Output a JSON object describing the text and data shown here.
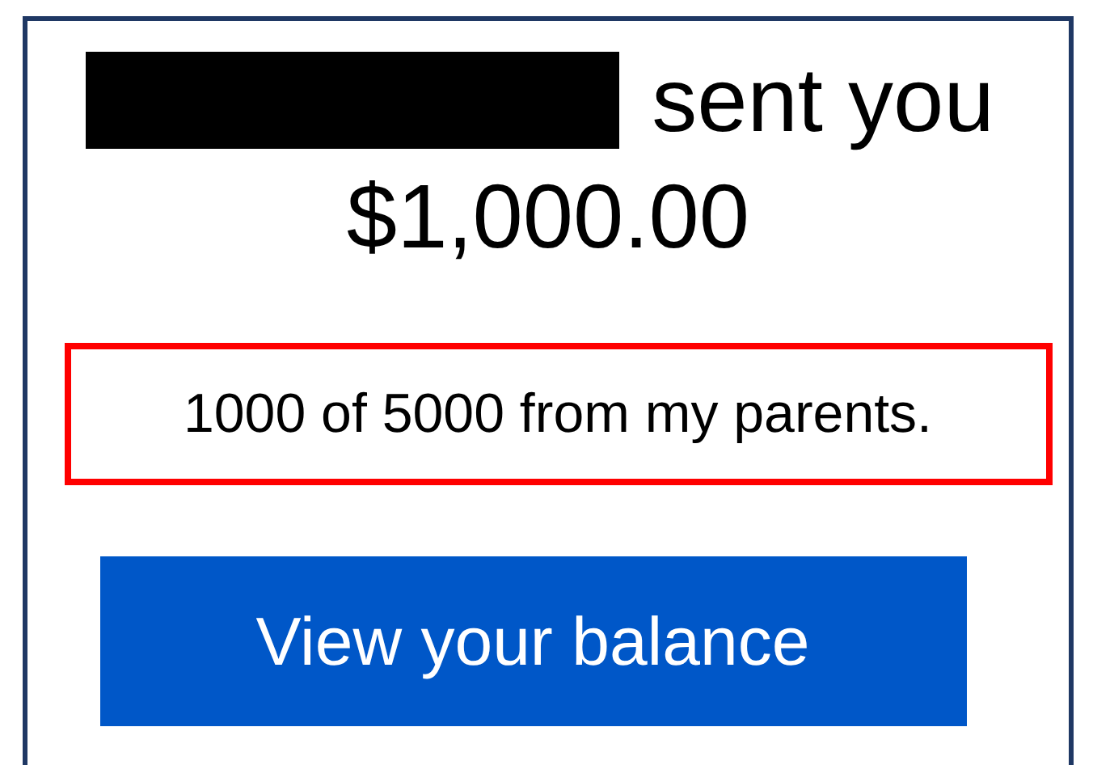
{
  "notification": {
    "headline_suffix": "sent you",
    "amount": "$1,000.00",
    "message": "1000 of 5000 from my parents.",
    "button": "View your balance"
  }
}
